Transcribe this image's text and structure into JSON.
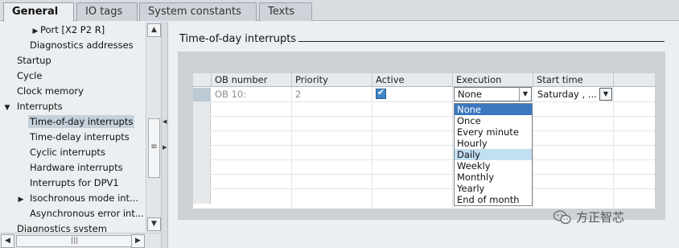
{
  "tabs": [
    {
      "label": "General"
    },
    {
      "label": "IO tags"
    },
    {
      "label": "System constants"
    },
    {
      "label": "Texts"
    }
  ],
  "tree": {
    "items": [
      {
        "label": "Port [X2 P2 R]",
        "arrow": "▶"
      },
      {
        "label": "Diagnostics addresses"
      },
      {
        "label": "Startup"
      },
      {
        "label": "Cycle"
      },
      {
        "label": "Clock memory"
      },
      {
        "label": "Interrupts",
        "arrow": "▼"
      },
      {
        "label": "Time-of-day interrupts"
      },
      {
        "label": "Time-delay interrupts"
      },
      {
        "label": "Cyclic interrupts"
      },
      {
        "label": "Hardware interrupts"
      },
      {
        "label": "Interrupts for DPV1"
      },
      {
        "label": "Isochronous mode int...",
        "arrow": "▶"
      },
      {
        "label": "Asynchronous error int..."
      },
      {
        "label": "Diagnostics system"
      }
    ]
  },
  "section": {
    "title": "Time-of-day interrupts"
  },
  "grid": {
    "headers": [
      "OB number",
      "Priority",
      "Active",
      "Execution",
      "Start time"
    ],
    "row": {
      "ob_number": "OB 10:",
      "priority": "2",
      "active": true,
      "execution": "None",
      "start_time": "Saturday , ..."
    }
  },
  "execution_options": [
    "None",
    "Once",
    "Every minute",
    "Hourly",
    "Daily",
    "Weekly",
    "Monthly",
    "Yearly",
    "End of month"
  ],
  "execution_selected": "None",
  "execution_hovered": "Daily",
  "watermark": {
    "text": "方正智芯"
  },
  "colors": {
    "selected": "#3b78c0",
    "hover": "#c3dff2",
    "checkbox": "#3f87c6"
  }
}
